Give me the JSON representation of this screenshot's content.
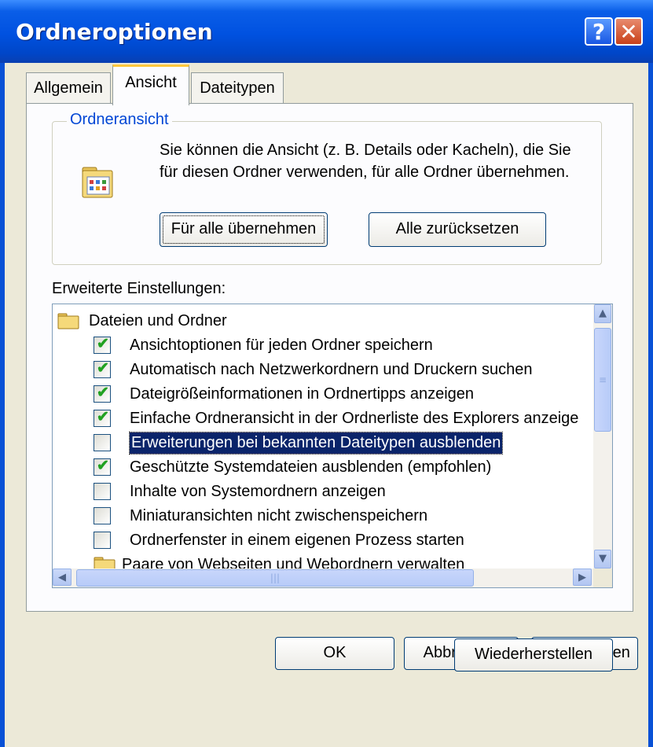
{
  "window": {
    "title": "Ordneroptionen",
    "help_glyph": "?",
    "close_glyph": "✕"
  },
  "tabs": [
    {
      "label": "Allgemein",
      "active": false
    },
    {
      "label": "Ansicht",
      "active": true
    },
    {
      "label": "Dateitypen",
      "active": false
    }
  ],
  "folder_view": {
    "legend": "Ordneransicht",
    "description": "Sie können die Ansicht (z. B. Details oder Kacheln), die Sie für diesen Ordner verwenden, für alle Ordner übernehmen.",
    "apply_all_label": "Für alle übernehmen",
    "reset_all_label": "Alle zurücksetzen"
  },
  "advanced": {
    "label": "Erweiterte Einstellungen:",
    "items": [
      {
        "type": "category",
        "icon": "folder-icon",
        "label": "Dateien und Ordner"
      },
      {
        "type": "checkbox",
        "checked": true,
        "label": "Ansichtoptionen für jeden Ordner speichern"
      },
      {
        "type": "checkbox",
        "checked": true,
        "label": "Automatisch nach Netzwerkordnern und Druckern suchen"
      },
      {
        "type": "checkbox",
        "checked": true,
        "label": "Dateigrößeinformationen in Ordnertipps anzeigen"
      },
      {
        "type": "checkbox",
        "checked": true,
        "label": "Einfache Ordneransicht in der Ordnerliste des Explorers anzeige"
      },
      {
        "type": "checkbox",
        "checked": false,
        "selected": true,
        "label": "Erweiterungen bei bekannten Dateitypen ausblenden"
      },
      {
        "type": "checkbox",
        "checked": true,
        "label": "Geschützte Systemdateien ausblenden (empfohlen)"
      },
      {
        "type": "checkbox",
        "checked": false,
        "label": "Inhalte von Systemordnern anzeigen"
      },
      {
        "type": "checkbox",
        "checked": false,
        "label": "Miniaturansichten nicht zwischenspeichern"
      },
      {
        "type": "checkbox",
        "checked": false,
        "label": "Ordnerfenster in einem eigenen Prozess starten"
      },
      {
        "type": "subfolder",
        "icon": "folder-icon",
        "label": "Paare von Webseiten und Webordnern verwalten"
      }
    ]
  },
  "buttons": {
    "restore": "Wiederherstellen",
    "ok": "OK",
    "cancel": "Abbrechen",
    "apply": "Übernehmen"
  }
}
